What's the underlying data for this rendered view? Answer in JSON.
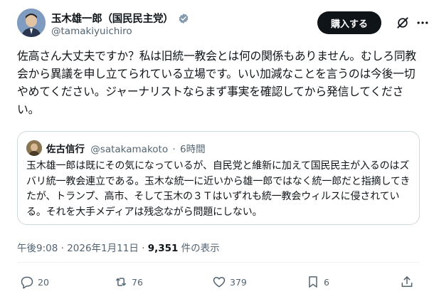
{
  "author": {
    "display_name": "玉木雄一郎（国民民主党）",
    "handle": "@tamakiyuichiro"
  },
  "header": {
    "buy_label": "購入する"
  },
  "tweet": {
    "text": "佐高さん大丈夫ですか？私は旧統一教会とは何の関係もありません。むしろ同教会から異議を申し立てられている立場です。いい加減なことを言うのは今後一切やめてください。ジャーナリストならまず事実を確認してから発信してください。"
  },
  "quote": {
    "name": "佐古信行",
    "handle": "@satakamakoto",
    "dot": "·",
    "time": "6時間",
    "text": "玉木雄一郎は既にその気になっているが、自民党と維新に加えて国民民主が入るのはズバリ統一教会連立である。玉木な統一に近いから雄一郎ではなく統一郎だと指摘してきたが、トランプ、高市、そして玉木の３Ｔはいずれも統一教会ウィルスに侵されている。それを大手メディアは残念ながら問題にしない。"
  },
  "meta": {
    "time": "午後9:08 · 2026年1月11日 · ",
    "views": "9,351",
    "views_label": " 件の表示"
  },
  "actions": {
    "replies": "20",
    "reposts": "76",
    "likes": "379",
    "bookmarks": "6"
  },
  "colors": {
    "verified": "#829aab",
    "text": "#0f1419",
    "muted": "#536471",
    "border": "#cfd9de"
  }
}
